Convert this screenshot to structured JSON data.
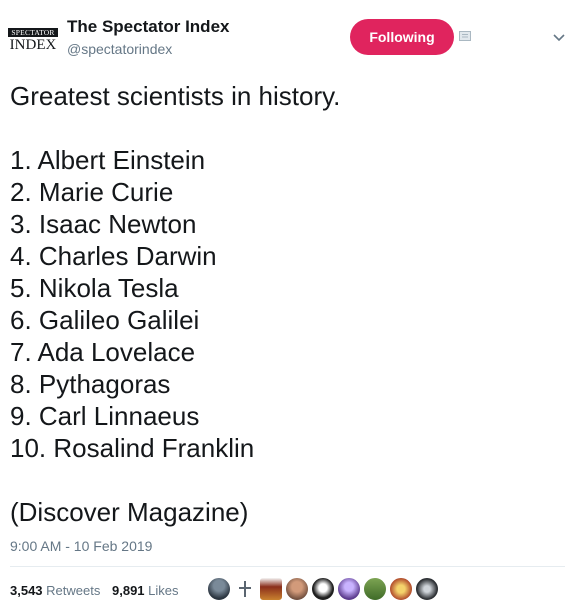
{
  "account": {
    "logo_top": "SPECTATOR",
    "logo_bottom": "INDEX",
    "name": "The Spectator Index",
    "handle": "@spectatorindex",
    "follow_label": "Following"
  },
  "tweet": {
    "intro": "Greatest scientists in history.",
    "list": [
      "1. Albert Einstein",
      "2. Marie Curie",
      "3. Isaac Newton",
      "4. Charles Darwin",
      "5. Nikola Tesla",
      "6. Galileo Galilei",
      "7. Ada Lovelace",
      "8. Pythagoras",
      "9. Carl Linnaeus",
      "10. Rosalind Franklin"
    ],
    "source": "(Discover Magazine)",
    "timestamp": "9:00 AM - 10 Feb 2019"
  },
  "stats": {
    "retweets_count": "3,543",
    "retweets_label": "Retweets",
    "likes_count": "9,891",
    "likes_label": "Likes"
  },
  "colors": {
    "follow_button": "#e0245e",
    "secondary_text": "#657786",
    "primary_text": "#14171a"
  },
  "icons": {
    "chevron": "chevron-down-icon",
    "notifications": "notification-icon"
  }
}
